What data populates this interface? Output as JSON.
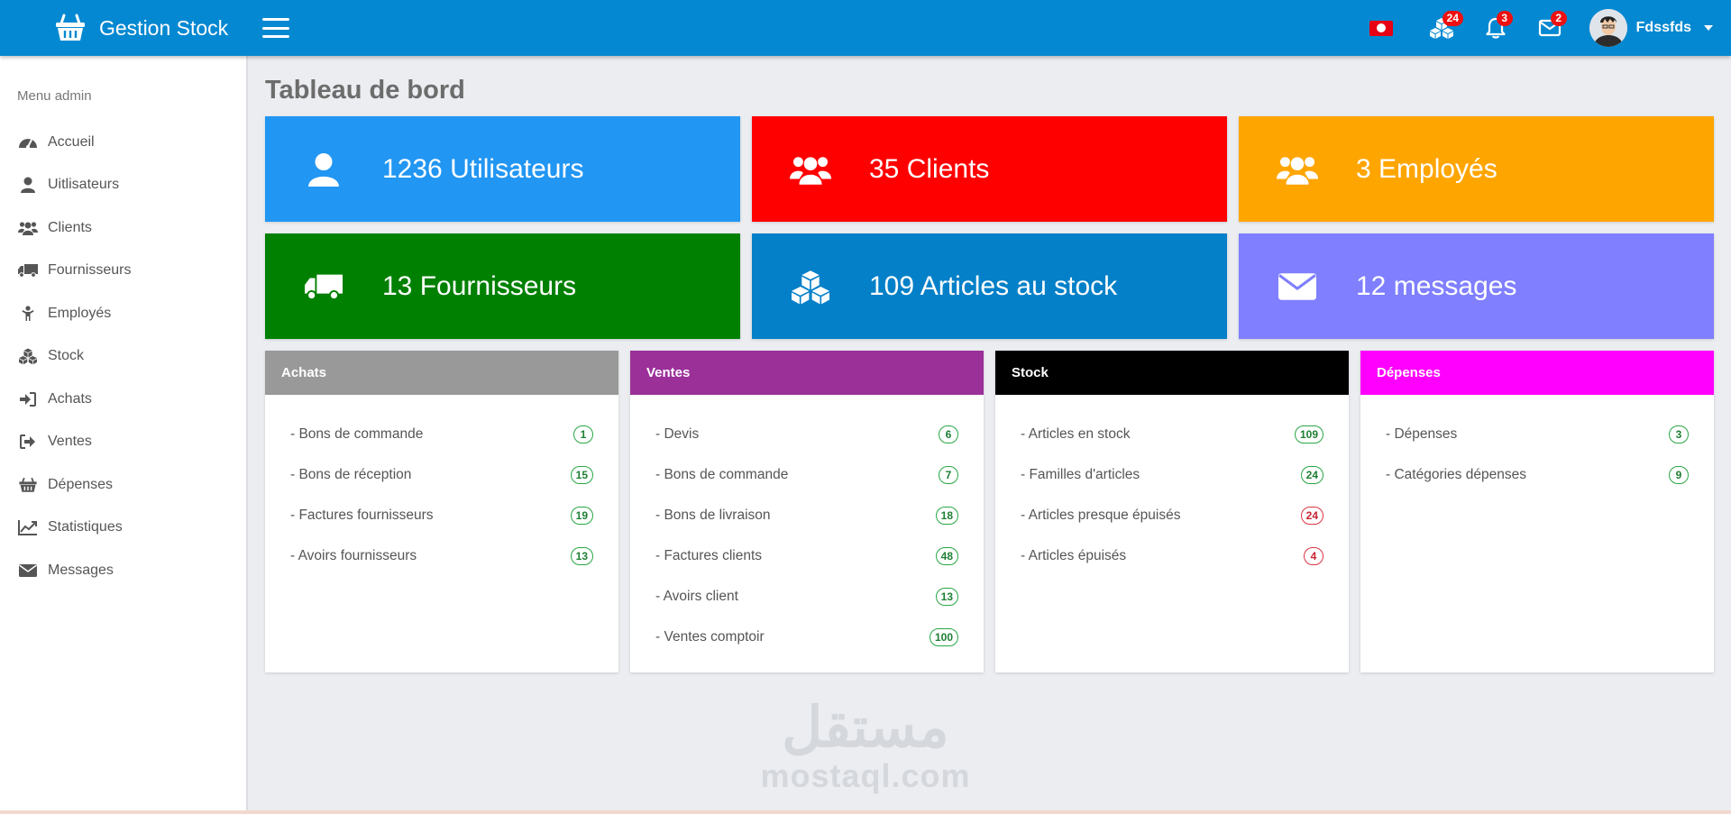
{
  "app": {
    "name": "Gestion Stock"
  },
  "topbar": {
    "badges": {
      "stock": "24",
      "notifications": "3",
      "messages": "2"
    },
    "user": {
      "name": "Fdssfds"
    }
  },
  "sidebar": {
    "title": "Menu admin",
    "items": [
      {
        "label": "Accueil",
        "icon": "dashboard-icon"
      },
      {
        "label": "Uitlisateurs",
        "icon": "user-icon"
      },
      {
        "label": "Clients",
        "icon": "users-icon"
      },
      {
        "label": "Fournisseurs",
        "icon": "truck-icon"
      },
      {
        "label": "Employés",
        "icon": "employee-icon"
      },
      {
        "label": "Stock",
        "icon": "cubes-icon"
      },
      {
        "label": "Achats",
        "icon": "sign-in-icon"
      },
      {
        "label": "Ventes",
        "icon": "sign-out-icon"
      },
      {
        "label": "Dépenses",
        "icon": "basket-icon"
      },
      {
        "label": "Statistiques",
        "icon": "line-chart-icon"
      },
      {
        "label": "Messages",
        "icon": "envelope-icon"
      }
    ]
  },
  "main": {
    "title": "Tableau de bord",
    "stats": [
      {
        "label": "1236 Utilisateurs",
        "color": "#2196f3",
        "icon": "user-icon"
      },
      {
        "label": "35 Clients",
        "color": "#ff0000",
        "icon": "users-icon"
      },
      {
        "label": "3 Employés",
        "color": "#ffa500",
        "icon": "users-icon"
      },
      {
        "label": "13 Fournisseurs",
        "color": "#008000",
        "icon": "truck-icon"
      },
      {
        "label": "109 Articles au stock",
        "color": "#0480c8",
        "icon": "cubes-icon"
      },
      {
        "label": "12 messages",
        "color": "#7f7fff",
        "icon": "envelope-icon"
      }
    ],
    "panels": [
      {
        "title": "Achats",
        "color": "#999999",
        "items": [
          {
            "label": "- Bons de commande",
            "count": "1"
          },
          {
            "label": "- Bons de réception",
            "count": "15"
          },
          {
            "label": "- Factures fournisseurs",
            "count": "19"
          },
          {
            "label": "- Avoirs fournisseurs",
            "count": "13"
          }
        ]
      },
      {
        "title": "Ventes",
        "color": "#9b3099",
        "items": [
          {
            "label": "- Devis",
            "count": "6"
          },
          {
            "label": "- Bons de commande",
            "count": "7"
          },
          {
            "label": "- Bons de livraison",
            "count": "18"
          },
          {
            "label": "- Factures clients",
            "count": "48"
          },
          {
            "label": "- Avoirs client",
            "count": "13"
          },
          {
            "label": "- Ventes comptoir",
            "count": "100"
          }
        ]
      },
      {
        "title": "Stock",
        "color": "#000000",
        "items": [
          {
            "label": "- Articles en stock",
            "count": "109"
          },
          {
            "label": "- Familles d'articles",
            "count": "24"
          },
          {
            "label": "- Articles presque épuisés",
            "count": "24",
            "status": "danger"
          },
          {
            "label": "- Articles épuisés",
            "count": "4",
            "status": "danger"
          }
        ]
      },
      {
        "title": "Dépenses",
        "color": "#ff00ff",
        "items": [
          {
            "label": "- Dépenses",
            "count": "3"
          },
          {
            "label": "- Catégories dépenses",
            "count": "9"
          }
        ]
      }
    ]
  },
  "watermark": {
    "arabic": "مستقل",
    "latin": "mostaql.com"
  }
}
